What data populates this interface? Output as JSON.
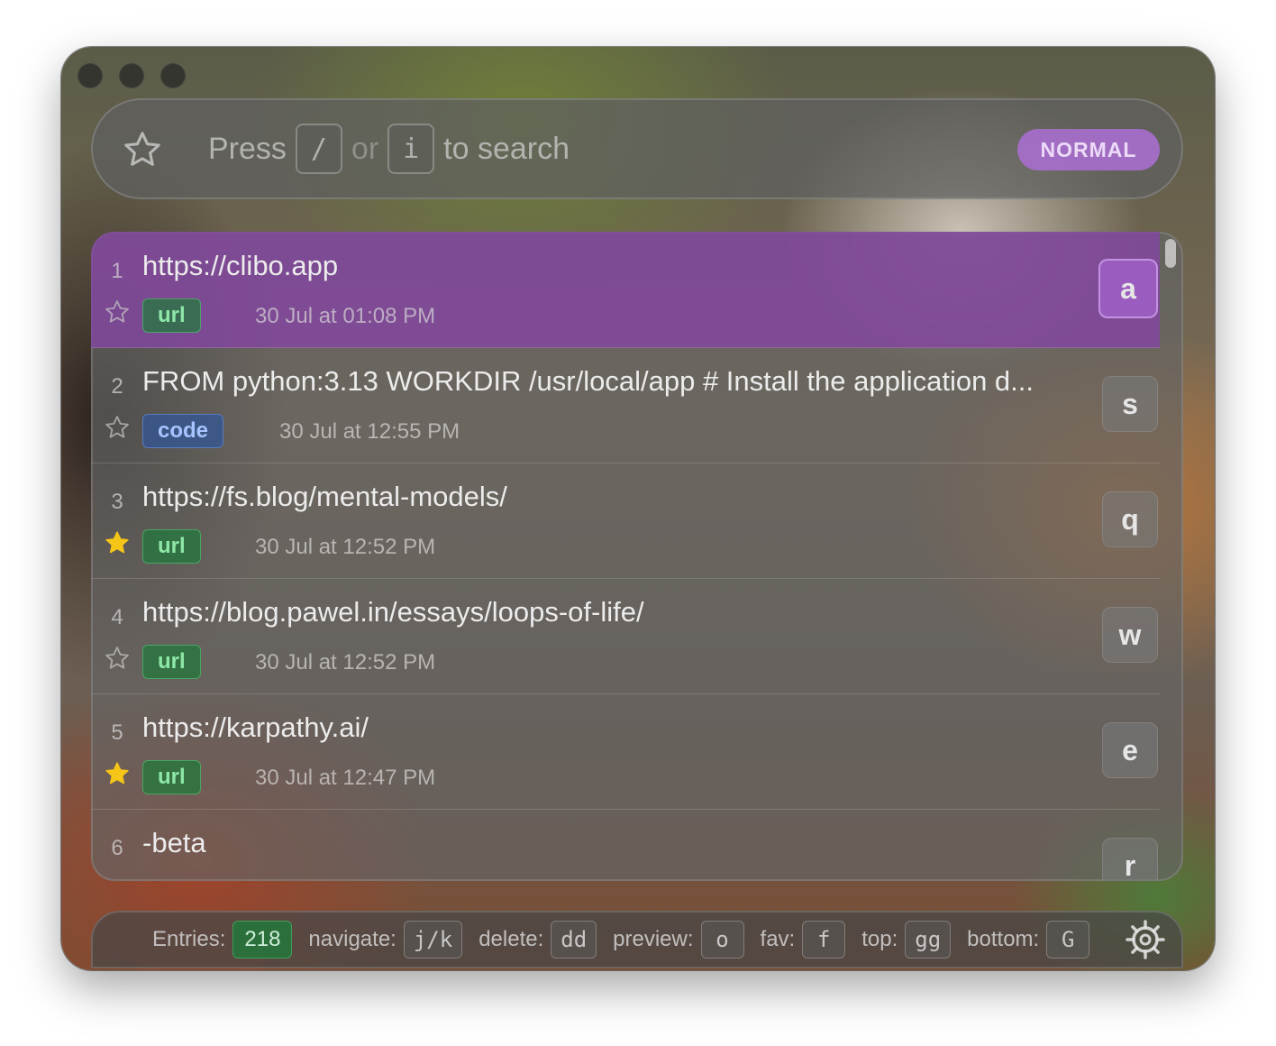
{
  "search": {
    "hint_press": "Press",
    "hint_key1": "/",
    "hint_or": "or",
    "hint_key2": "i",
    "hint_tail": "to search",
    "mode": "NORMAL"
  },
  "entries": [
    {
      "index": "1",
      "text": "https://clibo.app",
      "tag": "url",
      "time": "30 Jul at 01:08 PM",
      "favorite": false,
      "hotkey": "a",
      "selected": true
    },
    {
      "index": "2",
      "text": "FROM python:3.13 WORKDIR /usr/local/app # Install the application d...",
      "tag": "code",
      "time": "30 Jul at 12:55 PM",
      "favorite": false,
      "hotkey": "s"
    },
    {
      "index": "3",
      "text": "https://fs.blog/mental-models/",
      "tag": "url",
      "time": "30 Jul at 12:52 PM",
      "favorite": true,
      "hotkey": "q"
    },
    {
      "index": "4",
      "text": "https://blog.pawel.in/essays/loops-of-life/",
      "tag": "url",
      "time": "30 Jul at 12:52 PM",
      "favorite": false,
      "hotkey": "w"
    },
    {
      "index": "5",
      "text": "https://karpathy.ai/",
      "tag": "url",
      "time": "30 Jul at 12:47 PM",
      "favorite": true,
      "hotkey": "e"
    },
    {
      "index": "6",
      "text": "-beta",
      "tag": "",
      "time": "",
      "favorite": false,
      "hotkey": "r"
    }
  ],
  "status": {
    "entries_label": "Entries:",
    "entries_count": "218",
    "navigate_label": "navigate:",
    "navigate_key": "j/k",
    "delete_label": "delete:",
    "delete_key": "dd",
    "preview_label": "preview:",
    "preview_key": "o",
    "fav_label": "fav:",
    "fav_key": "f",
    "top_label": "top:",
    "top_key": "gg",
    "bottom_label": "bottom:",
    "bottom_key": "G"
  },
  "icons": {
    "search_star": "star-outline-icon",
    "settings": "gear-icon"
  },
  "colors": {
    "accent_purple": "#a45fc8",
    "url_tag": "#8de8a7",
    "code_tag": "#a6c4ff",
    "favorite_star": "#f5c518"
  }
}
